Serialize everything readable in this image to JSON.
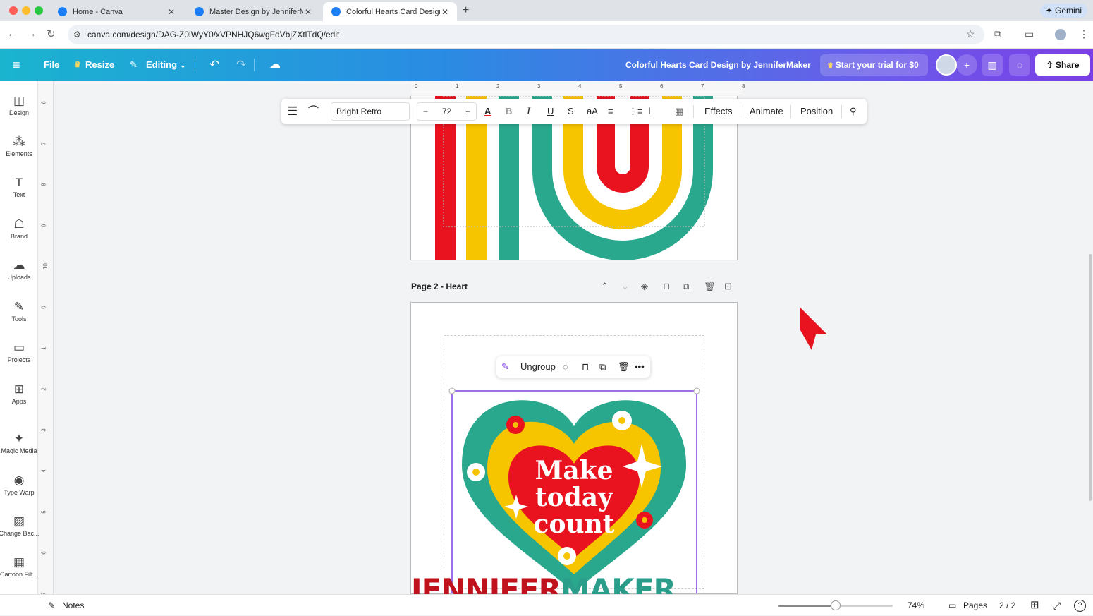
{
  "browser": {
    "tabs": [
      {
        "title": "Home - Canva"
      },
      {
        "title": "Master Design by JenniferMaker"
      },
      {
        "title": "Colorful Hearts Card Design by JenniferMaker",
        "active": true
      }
    ],
    "new_tab": "+",
    "gemini": "✦ Gemini",
    "url": "canva.com/design/DAG-Z0lWyY0/xVPNHJQ6wgFdVbjZXtlTdQ/edit"
  },
  "topbar": {
    "menu_icon": "menu-icon",
    "file": "File",
    "resize": "Resize",
    "editing": "Editing",
    "doc_title": "Colorful Hearts Card Design by JenniferMaker",
    "trial": "Start your trial for $0",
    "share": "Share"
  },
  "sidebar": {
    "items": [
      {
        "label": "Design",
        "icon": "design-icon",
        "glyph": "◫"
      },
      {
        "label": "Elements",
        "icon": "elements-icon",
        "glyph": "⁂"
      },
      {
        "label": "Text",
        "icon": "text-icon",
        "glyph": "T"
      },
      {
        "label": "Brand",
        "icon": "brand-icon",
        "glyph": "☖"
      },
      {
        "label": "Uploads",
        "icon": "uploads-icon",
        "glyph": "☁"
      },
      {
        "label": "Tools",
        "icon": "tools-icon",
        "glyph": "✎"
      },
      {
        "label": "Projects",
        "icon": "projects-icon",
        "glyph": "▭"
      },
      {
        "label": "Apps",
        "icon": "apps-icon",
        "glyph": "⊞"
      },
      {
        "label": "Magic Media",
        "icon": "magic-media-icon",
        "glyph": "✦"
      },
      {
        "label": "Type Warp",
        "icon": "type-warp-icon",
        "glyph": "◉"
      },
      {
        "label": "Change Bac...",
        "icon": "change-background-icon",
        "glyph": "▨"
      },
      {
        "label": "Cartoon Filt...",
        "icon": "cartoon-filter-icon",
        "glyph": "▦"
      }
    ]
  },
  "ruler": {
    "horizontal": [
      "0",
      "1",
      "2",
      "3",
      "4",
      "5",
      "6",
      "7",
      "8"
    ],
    "vertical": [
      "6",
      "7",
      "8",
      "9",
      "10",
      "0",
      "1",
      "2",
      "3",
      "4",
      "5",
      "6",
      "7"
    ]
  },
  "text_toolbar": {
    "font": "Bright Retro",
    "size": "72",
    "minus": "−",
    "plus": "+",
    "effects": "Effects",
    "animate": "Animate",
    "position": "Position"
  },
  "page2": {
    "label": "Page 2 - Heart"
  },
  "group_toolbar": {
    "ungroup": "Ungroup",
    "more": "•••"
  },
  "design": {
    "heart_text": [
      "Make",
      "today",
      "count"
    ],
    "colors": {
      "red": "#e8131e",
      "yellow": "#f7c400",
      "teal": "#2aa88e"
    }
  },
  "watermark": {
    "part1": "JENNIFER",
    "part2": "MAKER"
  },
  "bottombar": {
    "notes": "Notes",
    "zoom": "74%",
    "zoom_fraction": 0.5,
    "pages": "Pages",
    "page_count": "2 / 2",
    "help": "?"
  }
}
